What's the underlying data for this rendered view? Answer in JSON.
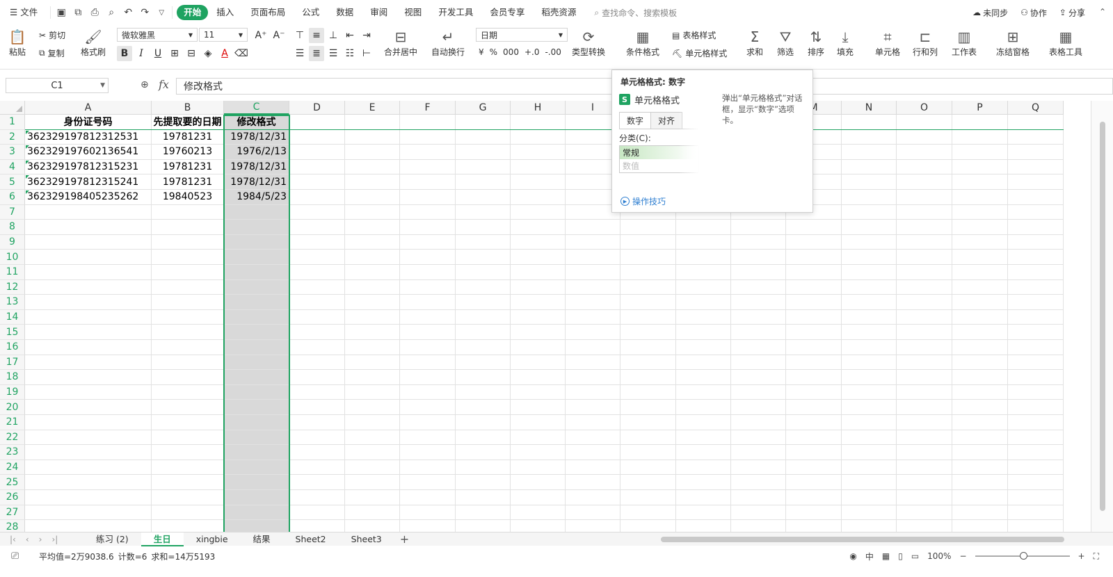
{
  "menubar": {
    "file": "文件",
    "tabs": [
      "开始",
      "插入",
      "页面布局",
      "公式",
      "数据",
      "审阅",
      "视图",
      "开发工具",
      "会员专享",
      "稻壳资源"
    ],
    "active_tab": "开始",
    "search_placeholder": "查找命令、搜索模板",
    "sync": "未同步",
    "collab": "协作",
    "share": "分享"
  },
  "ribbon": {
    "paste": "粘贴",
    "cut": "剪切",
    "copy": "复制",
    "format_painter": "格式刷",
    "font_name": "微软雅黑",
    "font_size": "11",
    "number_format": "日期",
    "merge_center": "合并居中",
    "wrap_text": "自动换行",
    "type_convert": "类型转换",
    "cond_format": "条件格式",
    "table_style": "表格样式",
    "cell_style": "单元格样式",
    "sum": "求和",
    "filter": "筛选",
    "sort": "排序",
    "fill": "填充",
    "cell": "单元格",
    "row_col": "行和列",
    "worksheet": "工作表",
    "freeze": "冻结窗格",
    "table_tool": "表格工具"
  },
  "formula_bar": {
    "name_box": "C1",
    "fx": "fx",
    "content": "修改格式"
  },
  "grid": {
    "columns": [
      "A",
      "B",
      "C",
      "D",
      "E",
      "F",
      "G",
      "H",
      "I",
      "J",
      "K",
      "L",
      "M",
      "N",
      "O",
      "P",
      "Q"
    ],
    "selected_column": "C",
    "rows": [
      [
        "身份证号码",
        "先提取要的日期",
        "修改格式"
      ],
      [
        "362329197812312531",
        "19781231",
        "1978/12/31"
      ],
      [
        "362329197602136541",
        "19760213",
        "1976/2/13"
      ],
      [
        "362329197812315231",
        "19781231",
        "1978/12/31"
      ],
      [
        "362329197812315241",
        "19781231",
        "1978/12/31"
      ],
      [
        "362329198405235262",
        "19840523",
        "1984/5/23"
      ]
    ],
    "row_count": 28
  },
  "popup": {
    "title": "单元格格式: 数字",
    "mini_title": "单元格格式",
    "tab_number": "数字",
    "tab_align": "对齐",
    "category_label": "分类(C):",
    "cat_general": "常规",
    "cat_number": "数值",
    "description": "弹出“单元格格式”对话框，显示“数字”选项卡。",
    "tip": "操作技巧"
  },
  "sheet_tabs": [
    "练习 (2)",
    "生日",
    "xingbie",
    "结果",
    "Sheet2",
    "Sheet3"
  ],
  "active_sheet": "生日",
  "statusbar": {
    "average": "平均值=2万9038.6",
    "count": "计数=6",
    "sum": "求和=14万5193",
    "zoom": "100%"
  },
  "colors": {
    "accent": "#1fa361",
    "highlight": "#e02020"
  }
}
